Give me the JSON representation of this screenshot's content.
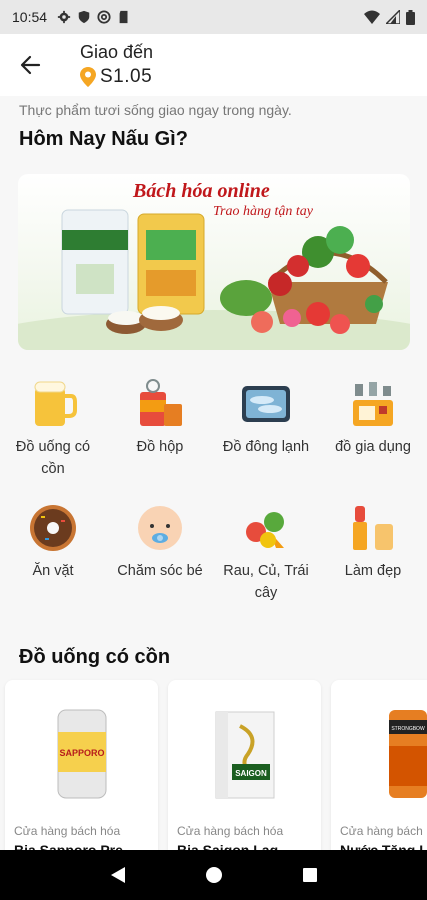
{
  "status_bar": {
    "time": "10:54",
    "left_icons": [
      "gear-icon",
      "shield-icon",
      "at-sign-icon",
      "sd-card-icon"
    ],
    "right_icons": [
      "wifi-icon",
      "signal-icon",
      "battery-icon"
    ]
  },
  "header": {
    "deliver_label": "Giao đến",
    "location": "S1.05",
    "location_icon": "map-pin-icon",
    "accent": "#f5a623"
  },
  "main": {
    "subtitle": "Thực phẩm tươi sống giao ngay trong ngày.",
    "section_title": "Hôm Nay Nấu Gì?",
    "banner": {
      "title": "Bách hóa online",
      "subtitle": "Trao hàng tận tay"
    },
    "categories": [
      {
        "label": "Đồ uống có cồn",
        "icon": "beer-mug-icon"
      },
      {
        "label": "Đồ hộp",
        "icon": "canned-food-icon"
      },
      {
        "label": "Đồ đông lạnh",
        "icon": "frozen-fish-icon"
      },
      {
        "label": "đồ gia dụng",
        "icon": "household-appliance-icon"
      },
      {
        "label": "Ăn vặt",
        "icon": "donut-icon"
      },
      {
        "label": "Chăm sóc bé",
        "icon": "baby-face-icon"
      },
      {
        "label": "Rau, Củ, Trái cây",
        "icon": "vegetables-icon"
      },
      {
        "label": "Làm đẹp",
        "icon": "lipstick-icon"
      }
    ],
    "products_section_title": "Đồ uống có cồn",
    "products": [
      {
        "store": "Cửa hàng bách hóa",
        "name": "Bia Sapporo Pre",
        "image_label": "SAPPORO"
      },
      {
        "store": "Cửa hàng bách hóa",
        "name": "Bia Saigon Lag",
        "image_label": "SAIGON"
      },
      {
        "store": "Cửa hàng bách",
        "name": "Nước Tăng Lực",
        "image_label": "STRONGBOW"
      }
    ]
  },
  "nav_bar": {
    "icons": [
      "back-triangle-icon",
      "home-circle-icon",
      "recents-square-icon"
    ]
  }
}
